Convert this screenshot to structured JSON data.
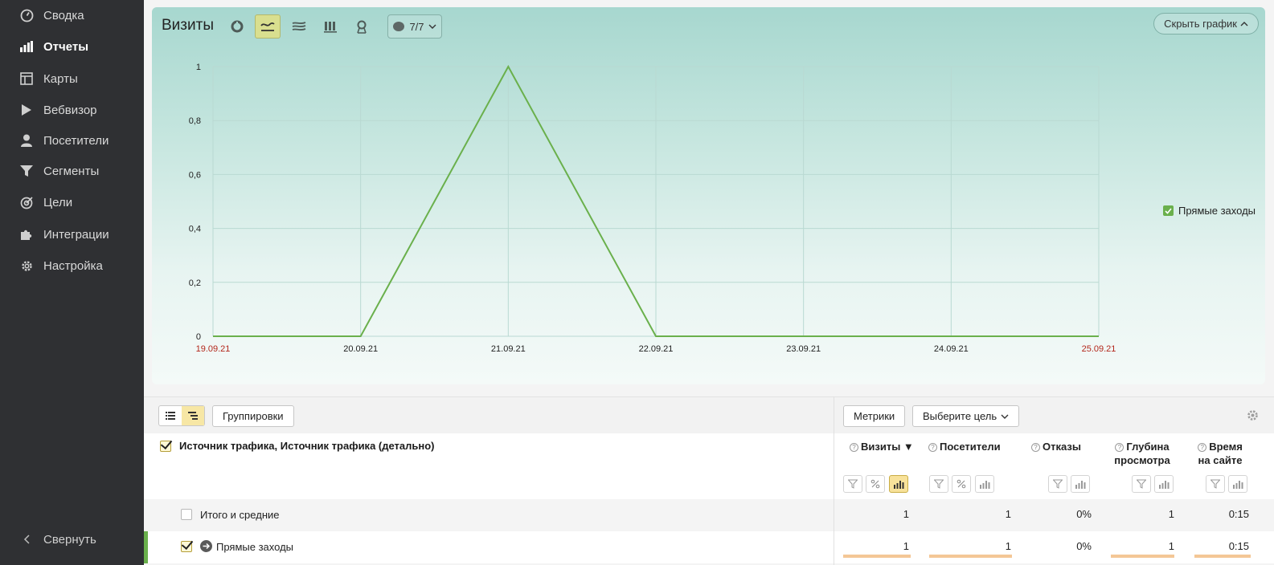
{
  "sidebar": {
    "items": [
      {
        "label": "Сводка",
        "icon": "dashboard-icon"
      },
      {
        "label": "Отчеты",
        "icon": "bar-chart-icon",
        "active": true
      },
      {
        "label": "Карты",
        "icon": "map-icon"
      },
      {
        "label": "Вебвизор",
        "icon": "play-icon"
      },
      {
        "label": "Посетители",
        "icon": "user-icon"
      },
      {
        "label": "Сегменты",
        "icon": "filter-icon"
      },
      {
        "label": "Цели",
        "icon": "target-icon"
      },
      {
        "label": "Интеграции",
        "icon": "puzzle-icon"
      },
      {
        "label": "Настройка",
        "icon": "gear-icon"
      }
    ],
    "collapse_label": "Свернуть"
  },
  "chart_panel": {
    "title": "Визиты",
    "segments_label": "7/7",
    "hide_chart_label": "Скрыть график",
    "legend_label": "Прямые заходы",
    "accent_color": "#6ab04c"
  },
  "chart_data": {
    "type": "line",
    "x": [
      "19.09.21",
      "20.09.21",
      "21.09.21",
      "22.09.21",
      "23.09.21",
      "24.09.21",
      "25.09.21"
    ],
    "series": [
      {
        "name": "Прямые заходы",
        "values": [
          0,
          0,
          1,
          0,
          0,
          0,
          0
        ]
      }
    ],
    "y_ticks": [
      "0",
      "0,2",
      "0,4",
      "0,6",
      "0,8",
      "1"
    ],
    "ylim": [
      0,
      1
    ],
    "grid": true,
    "weekend_labels": [
      "19.09.21",
      "25.09.21"
    ],
    "legend": "right"
  },
  "toolbar": {
    "groupings_label": "Группировки",
    "metrics_label": "Метрики",
    "goal_label": "Выберите цель"
  },
  "table": {
    "dimension_header": "Источник трафика, Источник трафика (детально)",
    "columns": [
      {
        "label": "Визиты ▼"
      },
      {
        "label": "Посетители"
      },
      {
        "label": "Отказы"
      },
      {
        "label": "Глубина просмотра"
      },
      {
        "label": "Время на сайте"
      }
    ],
    "total_row": {
      "label": "Итого и средние",
      "values": [
        "1",
        "1",
        "0%",
        "1",
        "0:15"
      ]
    },
    "rows": [
      {
        "label": "Прямые заходы",
        "values": [
          "1",
          "1",
          "0%",
          "1",
          "0:15"
        ]
      }
    ]
  }
}
